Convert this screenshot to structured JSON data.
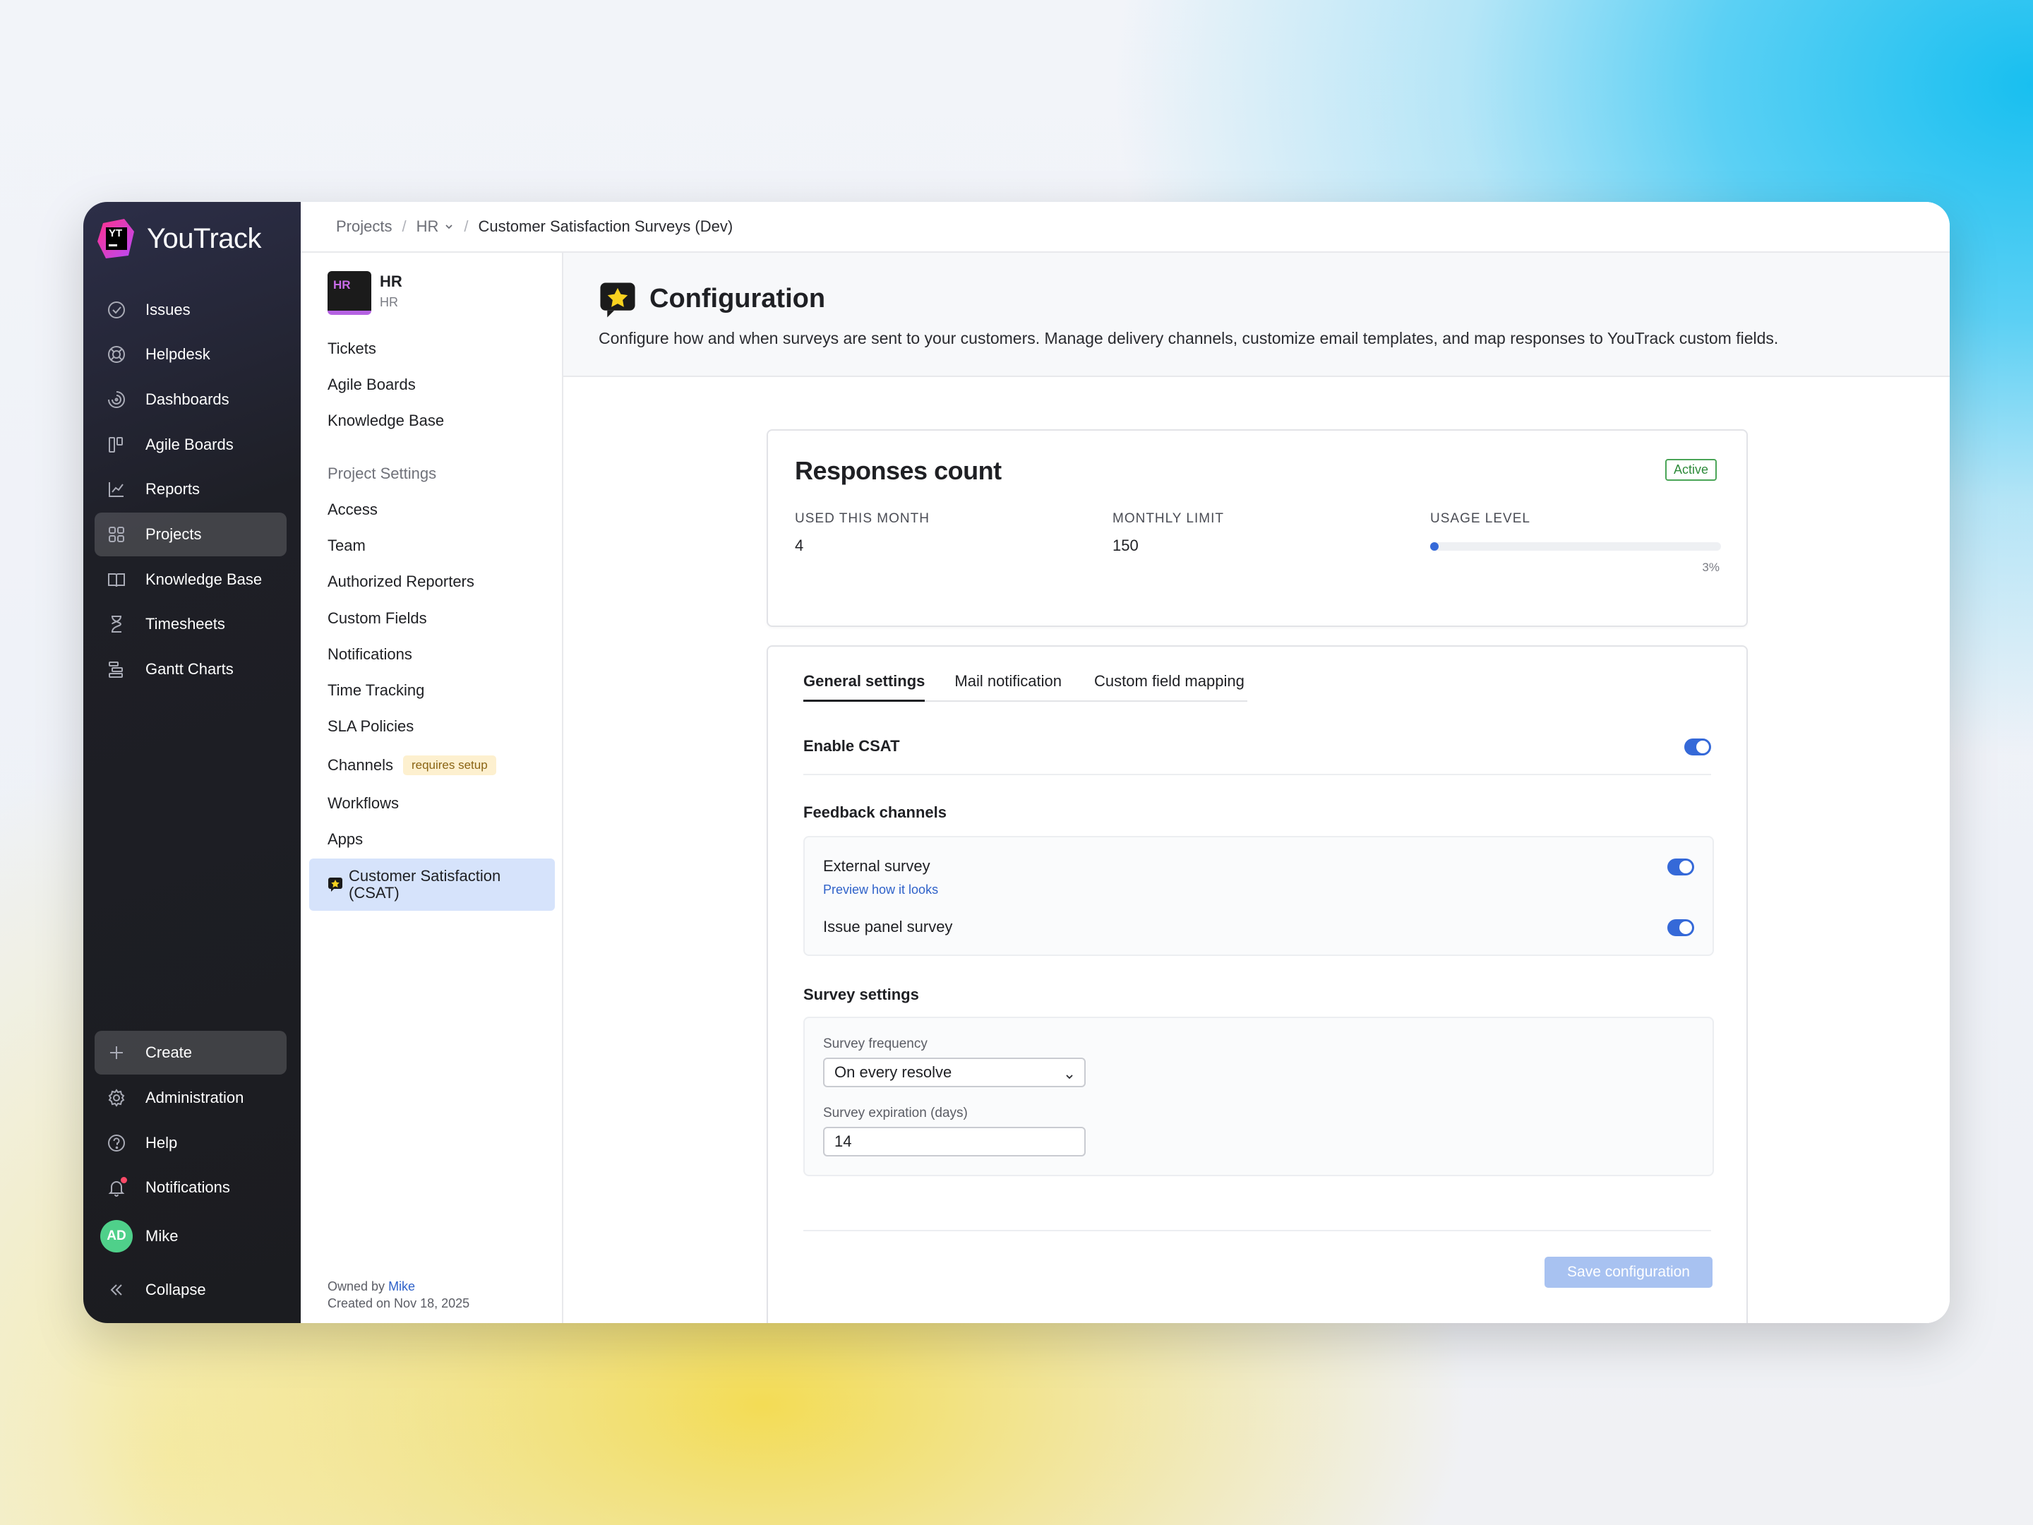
{
  "app": {
    "name": "YouTrack",
    "logo_letters": "YT"
  },
  "sidebar": {
    "items": [
      {
        "label": "Issues",
        "icon": "check-circle-icon"
      },
      {
        "label": "Helpdesk",
        "icon": "lifebuoy-icon"
      },
      {
        "label": "Dashboards",
        "icon": "dashboard-gauge-icon"
      },
      {
        "label": "Agile Boards",
        "icon": "board-columns-icon"
      },
      {
        "label": "Reports",
        "icon": "chart-line-icon"
      },
      {
        "label": "Projects",
        "icon": "grid-icon",
        "active": true
      },
      {
        "label": "Knowledge Base",
        "icon": "book-icon"
      },
      {
        "label": "Timesheets",
        "icon": "hourglass-icon"
      },
      {
        "label": "Gantt Charts",
        "icon": "gantt-icon"
      }
    ],
    "bottom": [
      {
        "label": "Create",
        "icon": "plus-icon"
      },
      {
        "label": "Administration",
        "icon": "gear-icon"
      },
      {
        "label": "Help",
        "icon": "help-circle-icon"
      },
      {
        "label": "Notifications",
        "icon": "bell-icon"
      }
    ],
    "user": {
      "initials": "AD",
      "name": "Mike"
    },
    "collapse_label": "Collapse"
  },
  "breadcrumb": {
    "projects": "Projects",
    "project": "HR",
    "current": "Customer Satisfaction Surveys (Dev)"
  },
  "project": {
    "tile": "HR",
    "name": "HR",
    "key": "HR",
    "links": [
      "Tickets",
      "Agile Boards",
      "Knowledge Base"
    ],
    "settings_heading": "Project Settings",
    "settings": [
      "Access",
      "Team",
      "Authorized Reporters",
      "Custom Fields",
      "Notifications",
      "Time Tracking",
      "SLA Policies",
      "Channels",
      "Workflows",
      "Apps"
    ],
    "channels_badge": "requires setup",
    "active_item": "Customer Satisfaction (CSAT)",
    "owned_by_label": "Owned by",
    "owner": "Mike",
    "created": "Created on Nov 18, 2025"
  },
  "page": {
    "title": "Configuration",
    "description": "Configure how and when surveys are sent to your customers. Manage delivery channels, customize email templates, and map responses to YouTrack custom fields.",
    "more_label": "···"
  },
  "responses": {
    "title": "Responses count",
    "status": "Active",
    "used_label": "USED THIS MONTH",
    "used": "4",
    "limit_label": "MONTHLY LIMIT",
    "limit": "150",
    "usage_label": "USAGE LEVEL",
    "usage_percent_text": "3%",
    "usage_fraction": 0.03
  },
  "tabs": [
    "General settings",
    "Mail notification",
    "Custom field mapping"
  ],
  "settings": {
    "enable_label": "Enable CSAT",
    "enable_on": true,
    "channels_heading": "Feedback channels",
    "external_label": "External survey",
    "preview_link": "Preview how it looks",
    "issue_panel_label": "Issue panel survey",
    "survey_heading": "Survey settings",
    "frequency_label": "Survey frequency",
    "frequency_value": "On every resolve",
    "expiration_label": "Survey expiration (days)",
    "expiration_value": "14",
    "save_label": "Save configuration"
  },
  "colors": {
    "accent": "#3569d8",
    "active_badge": "#2e8a3a",
    "selected_item": "#d6e3fb",
    "badge_bg": "#fdf0cf"
  }
}
